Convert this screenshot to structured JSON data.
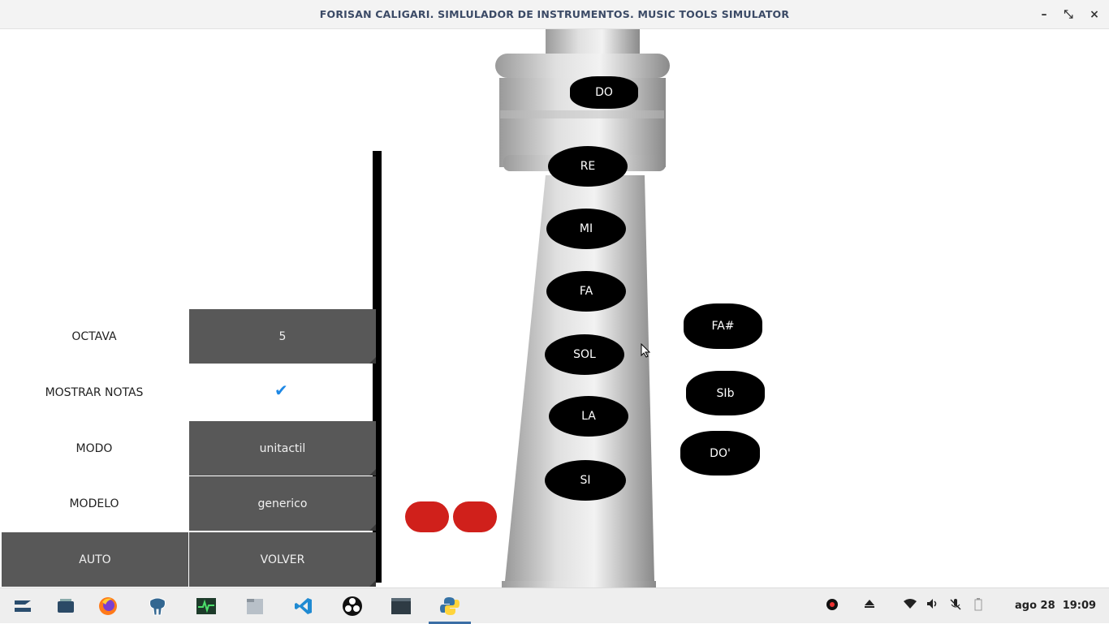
{
  "window": {
    "title": "FORISAN CALIGARI. SIMLULADOR DE INSTRUMENTOS. MUSIC TOOLS SIMULATOR",
    "minimize": "–",
    "restore": "⤡",
    "close": "×"
  },
  "settings": {
    "octava_label": "OCTAVA",
    "octava_value": "5",
    "mostrar_notas_label": "MOSTRAR NOTAS",
    "mostrar_notas_checked": "✔",
    "modo_label": "MODO",
    "modo_value": "unitactil",
    "modelo_label": "MODELO",
    "modelo_value": "generico",
    "auto_label": "AUTO",
    "volver_label": "VOLVER"
  },
  "flute_notes": [
    "DO",
    "RE",
    "MI",
    "FA",
    "SOL",
    "LA",
    "SI"
  ],
  "side_notes": [
    "FA#",
    "SIb",
    "DO'"
  ],
  "colors": {
    "button_bg": "#585858",
    "red_keys": "#d0201b",
    "check": "#1e88e5"
  },
  "taskbar": {
    "icons": [
      "zorin-menu-icon",
      "workspace-icon",
      "firefox-icon",
      "pgadmin-elephant-icon",
      "system-monitor-icon",
      "files-icon",
      "vscode-icon",
      "obs-icon",
      "terminal-icon",
      "python-icon"
    ],
    "clock_date": "ago 28",
    "clock_time": "19:09"
  }
}
